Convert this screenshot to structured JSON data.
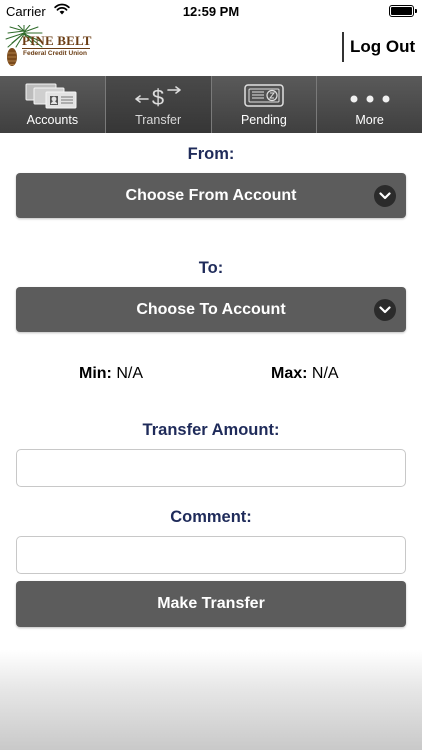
{
  "status_bar": {
    "carrier": "Carrier",
    "time": "12:59 PM"
  },
  "header": {
    "logo_text": "PINE BELT",
    "logo_subtext": "Federal Credit Union",
    "logout_label": "Log Out"
  },
  "nav": {
    "items": [
      {
        "label": "Accounts",
        "icon": "accounts-icon"
      },
      {
        "label": "Transfer",
        "icon": "transfer-icon",
        "active": true
      },
      {
        "label": "Pending",
        "icon": "pending-icon"
      },
      {
        "label": "More",
        "icon": "more-icon"
      }
    ]
  },
  "form": {
    "from_label": "From:",
    "from_select": "Choose From Account",
    "to_label": "To:",
    "to_select": "Choose To Account",
    "min_label": "Min:",
    "min_value": "N/A",
    "max_label": "Max:",
    "max_value": "N/A",
    "amount_label": "Transfer Amount:",
    "amount_value": "",
    "comment_label": "Comment:",
    "comment_value": "",
    "submit_label": "Make Transfer"
  },
  "colors": {
    "label_navy": "#1f2b5a",
    "button_gray": "#5c5c5c",
    "logo_brown": "#6b3d14",
    "pine_green": "#2f6b2a"
  }
}
